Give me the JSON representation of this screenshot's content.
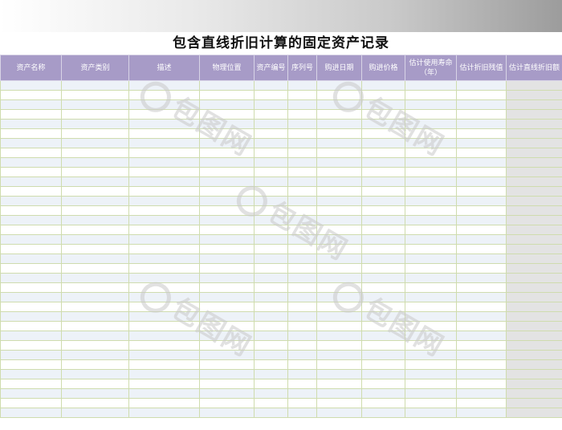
{
  "sheet": {
    "title": "包含直线折旧计算的固定资产记录",
    "columns": [
      "资产名称",
      "资产类别",
      "描述",
      "物理位置",
      "资产编号",
      "序列号",
      "购进日期",
      "购进价格",
      "估计使用寿命（年）",
      "估计折旧残值",
      "估计直线折旧额"
    ],
    "row_count": 35
  },
  "watermark": {
    "text": "包图网"
  },
  "colors": {
    "header_bg": "#a79bc7",
    "alt_row": "#edf2f8",
    "grid": "#cfdcae",
    "formula_col": "#e3e3e3"
  }
}
